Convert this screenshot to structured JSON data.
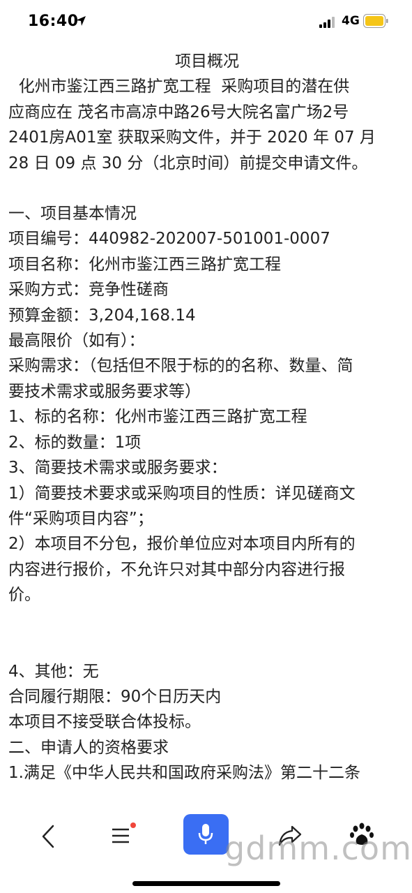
{
  "status_bar": {
    "time": "16:40",
    "network": "4G"
  },
  "article": {
    "title": "项目概况",
    "intro_lines": [
      "  化州市鉴江西三路扩宽工程  采购项目的潜在供",
      "应商应在  茂名市高凉中路26号大院名富广场2号",
      "2401房A01室  获取采购文件，并于 2020 年 07 月",
      "28 日 09 点 30 分（北京时间）前提交申请文件。"
    ],
    "section1_lines": [
      "一、项目基本情况",
      "项目编号：440982-202007-501001-0007",
      "项目名称：化州市鉴江西三路扩宽工程",
      "采购方式：竞争性磋商",
      "预算金额：3,204,168.14",
      "最高限价（如有）：",
      "采购需求：（包括但不限于标的的名称、数量、简",
      "要技术需求或服务要求等）",
      "1、标的名称：化州市鉴江西三路扩宽工程",
      "2、标的数量：1项",
      "3、简要技术需求或服务要求：",
      "1）简要技术要求或采购项目的性质：详见磋商文",
      "件“采购项目内容”；",
      "2）本项目不分包，报价单位应对本项目内所有的",
      "内容进行报价，不允许只对其中部分内容进行报",
      "价。"
    ],
    "section2_lines": [
      "4、其他：无",
      "合同履行期限：90个日历天内",
      "本项目不接受联合体投标。",
      "二、申请人的资格要求",
      "1.满足《中华人民共和国政府采购法》第二十二条"
    ]
  },
  "toolbar": {
    "icons": [
      "back-icon",
      "menu-icon",
      "voice-icon",
      "share-icon",
      "paw-icon"
    ],
    "accent_color": "#3a6ef3",
    "badge_color": "#f0463a"
  },
  "watermark": "gdmm.com"
}
